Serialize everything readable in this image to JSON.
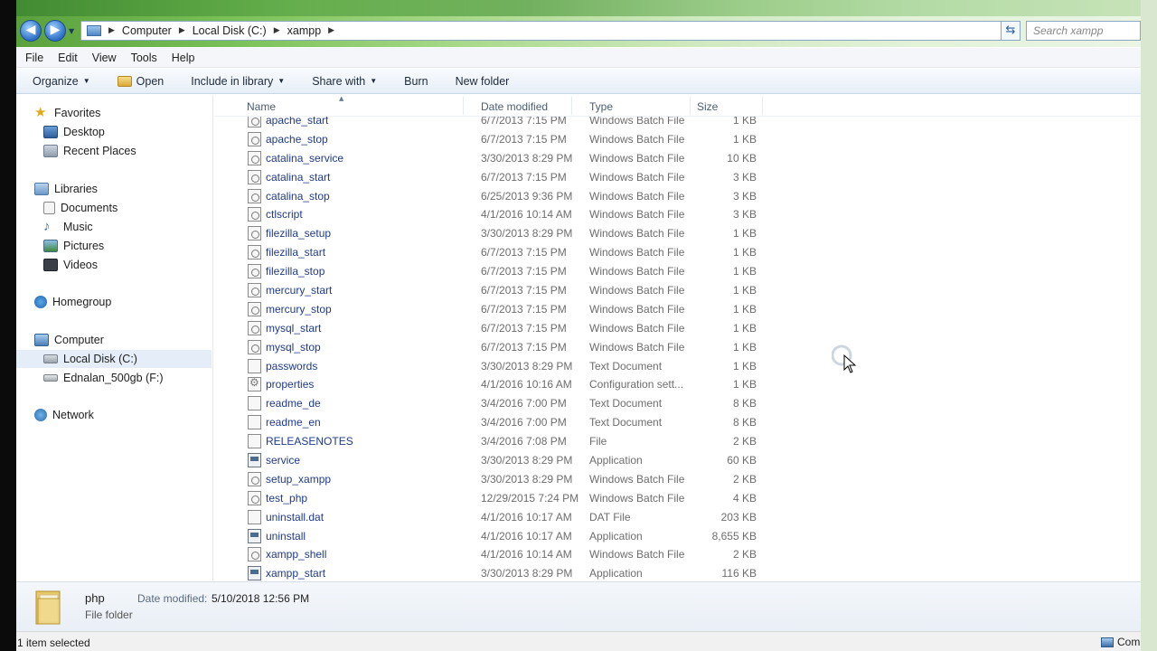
{
  "address": {
    "breadcrumbs": [
      "Computer",
      "Local Disk (C:)",
      "xampp"
    ],
    "search_placeholder": "Search xampp"
  },
  "menu": [
    "File",
    "Edit",
    "View",
    "Tools",
    "Help"
  ],
  "toolbar": {
    "organize": "Organize",
    "open": "Open",
    "include_in_library": "Include in library",
    "share_with": "Share with",
    "burn": "Burn",
    "new_folder": "New folder"
  },
  "nav": {
    "favorites": "Favorites",
    "desktop": "Desktop",
    "recent_places": "Recent Places",
    "libraries": "Libraries",
    "documents": "Documents",
    "music": "Music",
    "pictures": "Pictures",
    "videos": "Videos",
    "homegroup": "Homegroup",
    "computer": "Computer",
    "local_disk": "Local Disk (C:)",
    "ednalan": "Ednalan_500gb (F:)",
    "network": "Network"
  },
  "columns": {
    "name": "Name",
    "date_modified": "Date modified",
    "type": "Type",
    "size": "Size"
  },
  "files": [
    {
      "name": "apache_start",
      "date": "6/7/2013 7:15 PM",
      "type": "Windows Batch File",
      "size": "1 KB",
      "icon": "bat"
    },
    {
      "name": "apache_stop",
      "date": "6/7/2013 7:15 PM",
      "type": "Windows Batch File",
      "size": "1 KB",
      "icon": "bat"
    },
    {
      "name": "catalina_service",
      "date": "3/30/2013 8:29 PM",
      "type": "Windows Batch File",
      "size": "10 KB",
      "icon": "bat"
    },
    {
      "name": "catalina_start",
      "date": "6/7/2013 7:15 PM",
      "type": "Windows Batch File",
      "size": "3 KB",
      "icon": "bat"
    },
    {
      "name": "catalina_stop",
      "date": "6/25/2013 9:36 PM",
      "type": "Windows Batch File",
      "size": "3 KB",
      "icon": "bat"
    },
    {
      "name": "ctlscript",
      "date": "4/1/2016 10:14 AM",
      "type": "Windows Batch File",
      "size": "3 KB",
      "icon": "bat"
    },
    {
      "name": "filezilla_setup",
      "date": "3/30/2013 8:29 PM",
      "type": "Windows Batch File",
      "size": "1 KB",
      "icon": "bat"
    },
    {
      "name": "filezilla_start",
      "date": "6/7/2013 7:15 PM",
      "type": "Windows Batch File",
      "size": "1 KB",
      "icon": "bat"
    },
    {
      "name": "filezilla_stop",
      "date": "6/7/2013 7:15 PM",
      "type": "Windows Batch File",
      "size": "1 KB",
      "icon": "bat"
    },
    {
      "name": "mercury_start",
      "date": "6/7/2013 7:15 PM",
      "type": "Windows Batch File",
      "size": "1 KB",
      "icon": "bat"
    },
    {
      "name": "mercury_stop",
      "date": "6/7/2013 7:15 PM",
      "type": "Windows Batch File",
      "size": "1 KB",
      "icon": "bat"
    },
    {
      "name": "mysql_start",
      "date": "6/7/2013 7:15 PM",
      "type": "Windows Batch File",
      "size": "1 KB",
      "icon": "bat"
    },
    {
      "name": "mysql_stop",
      "date": "6/7/2013 7:15 PM",
      "type": "Windows Batch File",
      "size": "1 KB",
      "icon": "bat"
    },
    {
      "name": "passwords",
      "date": "3/30/2013 8:29 PM",
      "type": "Text Document",
      "size": "1 KB",
      "icon": "txt"
    },
    {
      "name": "properties",
      "date": "4/1/2016 10:16 AM",
      "type": "Configuration sett...",
      "size": "1 KB",
      "icon": "cfg"
    },
    {
      "name": "readme_de",
      "date": "3/4/2016 7:00 PM",
      "type": "Text Document",
      "size": "8 KB",
      "icon": "txt"
    },
    {
      "name": "readme_en",
      "date": "3/4/2016 7:00 PM",
      "type": "Text Document",
      "size": "8 KB",
      "icon": "txt"
    },
    {
      "name": "RELEASENOTES",
      "date": "3/4/2016 7:08 PM",
      "type": "File",
      "size": "2 KB",
      "icon": "txt"
    },
    {
      "name": "service",
      "date": "3/30/2013 8:29 PM",
      "type": "Application",
      "size": "60 KB",
      "icon": "app"
    },
    {
      "name": "setup_xampp",
      "date": "3/30/2013 8:29 PM",
      "type": "Windows Batch File",
      "size": "2 KB",
      "icon": "bat"
    },
    {
      "name": "test_php",
      "date": "12/29/2015 7:24 PM",
      "type": "Windows Batch File",
      "size": "4 KB",
      "icon": "bat"
    },
    {
      "name": "uninstall.dat",
      "date": "4/1/2016 10:17 AM",
      "type": "DAT File",
      "size": "203 KB",
      "icon": "txt"
    },
    {
      "name": "uninstall",
      "date": "4/1/2016 10:17 AM",
      "type": "Application",
      "size": "8,655 KB",
      "icon": "app"
    },
    {
      "name": "xampp_shell",
      "date": "4/1/2016 10:14 AM",
      "type": "Windows Batch File",
      "size": "2 KB",
      "icon": "bat"
    },
    {
      "name": "xampp_start",
      "date": "3/30/2013 8:29 PM",
      "type": "Application",
      "size": "116 KB",
      "icon": "app"
    }
  ],
  "details": {
    "name": "php",
    "kind": "File folder",
    "date_modified_label": "Date modified:",
    "date_modified_value": "5/10/2018 12:56 PM"
  },
  "status": {
    "text": "1 item selected",
    "right": "Com"
  }
}
